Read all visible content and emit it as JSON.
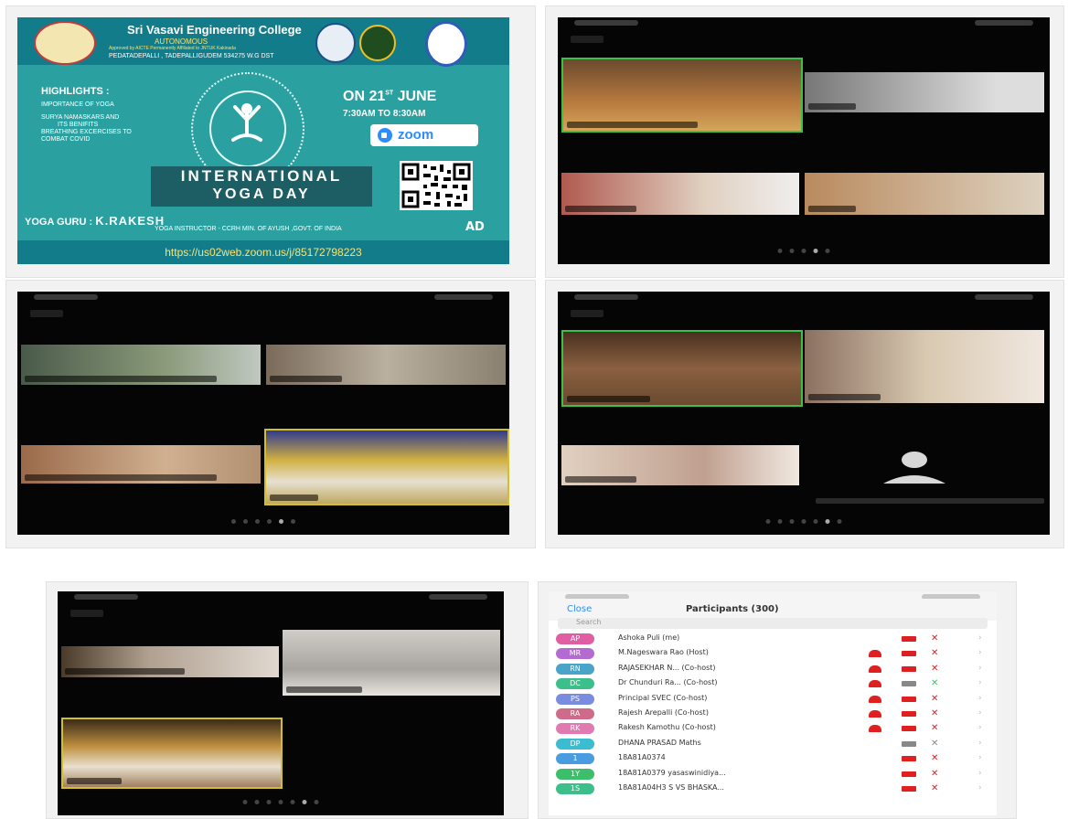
{
  "poster": {
    "college": "Sri Vasavi Engineering College",
    "autonomous": "AUTONOMOUS",
    "approval": "Approved by AICTE Permanently Affiliated to JNTUK Kakinada",
    "address": "PEDATADEPALLI , TADEPALLIGUDEM 534275 W.G DST",
    "highlights_title": "HIGHLIGHTS :",
    "highlights": [
      "IMPORTANCE OF YOGA",
      "SURYA NAMASKARS AND",
      "ITS BENIFITS",
      "BREATHING EXCERCISES TO",
      "COMBAT COVID"
    ],
    "date_prefix": "ON 21",
    "date_sup": "ST",
    "date_suffix": " JUNE",
    "time": "7:30AM  TO  8:30AM",
    "zoom_label": "zoom",
    "event_line1": "INTERNATIONAL",
    "event_line2": "YOGA DAY",
    "guru_label": "YOGA GURU : ",
    "guru_name": "K.RAKESH",
    "instructor": "YOGA INSTRUCTOR - CCRH MIN. OF AYUSH ,GOVT. OF INDIA",
    "zoom_url": "https://us02web.zoom.us/j/85172798223",
    "logo_ad": "AD",
    "accent": "#2aa1a0"
  },
  "participants": {
    "close_label": "Close",
    "title": "Participants (300)",
    "search_placeholder": "Search",
    "rows": [
      {
        "initials": "AP",
        "name": "Ashoka Puli (me)",
        "color": "#e05fa3"
      },
      {
        "initials": "MR",
        "name": "M.Nageswara Rao (Host)",
        "color": "#b36ad1"
      },
      {
        "initials": "RN",
        "name": "RAJASEKHAR N... (Co-host)",
        "color": "#4aa3c8"
      },
      {
        "initials": "DC",
        "name": "Dr Chunduri Ra... (Co-host)",
        "color": "#3cbf8a"
      },
      {
        "initials": "PS",
        "name": "Principal SVEC (Co-host)",
        "color": "#7a8ce0"
      },
      {
        "initials": "RA",
        "name": "Rajesh Arepalli (Co-host)",
        "color": "#d06a8a"
      },
      {
        "initials": "RK",
        "name": "Rakesh Kamothu (Co-host)",
        "color": "#e07ab0"
      },
      {
        "initials": "DP",
        "name": "DHANA PRASAD  Maths",
        "color": "#3bbcd0"
      },
      {
        "initials": "1",
        "name": "18A81A0374",
        "color": "#4a9ce0"
      },
      {
        "initials": "1Y",
        "name": "18A81A0379 yasaswinidiya...",
        "color": "#3cbf6a"
      },
      {
        "initials": "1S",
        "name": "18A81A04H3 S VS BHASKA...",
        "color": "#3cbf8a"
      }
    ]
  }
}
